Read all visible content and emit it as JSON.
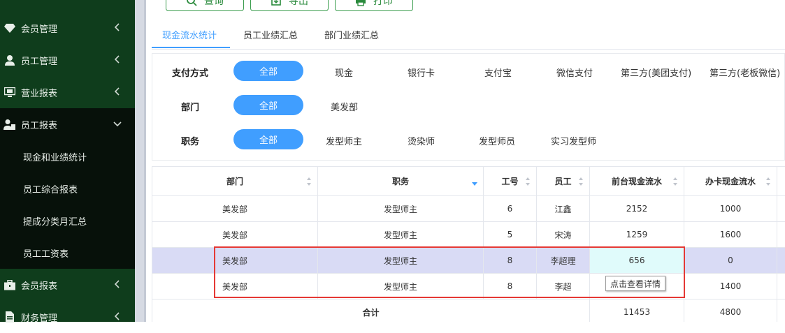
{
  "sidebar": {
    "items": [
      {
        "label": "会员管理",
        "icon": "diamond-icon"
      },
      {
        "label": "员工管理",
        "icon": "person-icon"
      },
      {
        "label": "营业报表",
        "icon": "monitor-icon"
      },
      {
        "label": "员工报表",
        "icon": "person-report-icon"
      },
      {
        "label": "会员报表",
        "icon": "briefcase-icon"
      },
      {
        "label": "财务管理",
        "icon": "document-icon"
      }
    ],
    "subitems": [
      "现金和业绩统计",
      "员工综合报表",
      "提成分类月汇总",
      "员工工资表"
    ]
  },
  "toolbar": {
    "query_label": "查询",
    "export_label": "导出",
    "print_label": "打印"
  },
  "tabs": [
    "现金流水统计",
    "员工业绩汇总",
    "部门业绩汇总"
  ],
  "filters": {
    "payment": {
      "label": "支付方式",
      "selected": "全部",
      "options": [
        "现金",
        "银行卡",
        "支付宝",
        "微信支付",
        "第三方(美团支付)",
        "第三方(老板微信)"
      ]
    },
    "dept": {
      "label": "部门",
      "selected": "全部",
      "options": [
        "美发部"
      ]
    },
    "position": {
      "label": "职务",
      "selected": "全部",
      "options": [
        "发型师主",
        "烫染师",
        "发型师员",
        "实习发型师"
      ]
    }
  },
  "table": {
    "headers": [
      "部门",
      "职务",
      "工号",
      "员工",
      "前台现金流水",
      "办卡现金流水"
    ],
    "rows": [
      [
        "美发部",
        "发型师主",
        "6",
        "江鑫",
        "2152",
        "1000"
      ],
      [
        "美发部",
        "发型师主",
        "5",
        "宋涛",
        "1259",
        "1600"
      ],
      [
        "美发部",
        "发型师主",
        "8",
        "李超理",
        "656",
        "0"
      ],
      [
        "美发部",
        "发型师主",
        "8",
        "李超",
        "",
        "1400"
      ]
    ],
    "total": {
      "label": "合计",
      "front_cash": "11453",
      "card_cash": "4800"
    }
  },
  "tooltip": "点击查看详情",
  "colors": {
    "sidebar": "#0f3d1c",
    "accent": "#409eff",
    "highlight_row": "#d9dbf5",
    "highlight_cell": "#e0fbfb",
    "annotation": "#e53935"
  }
}
